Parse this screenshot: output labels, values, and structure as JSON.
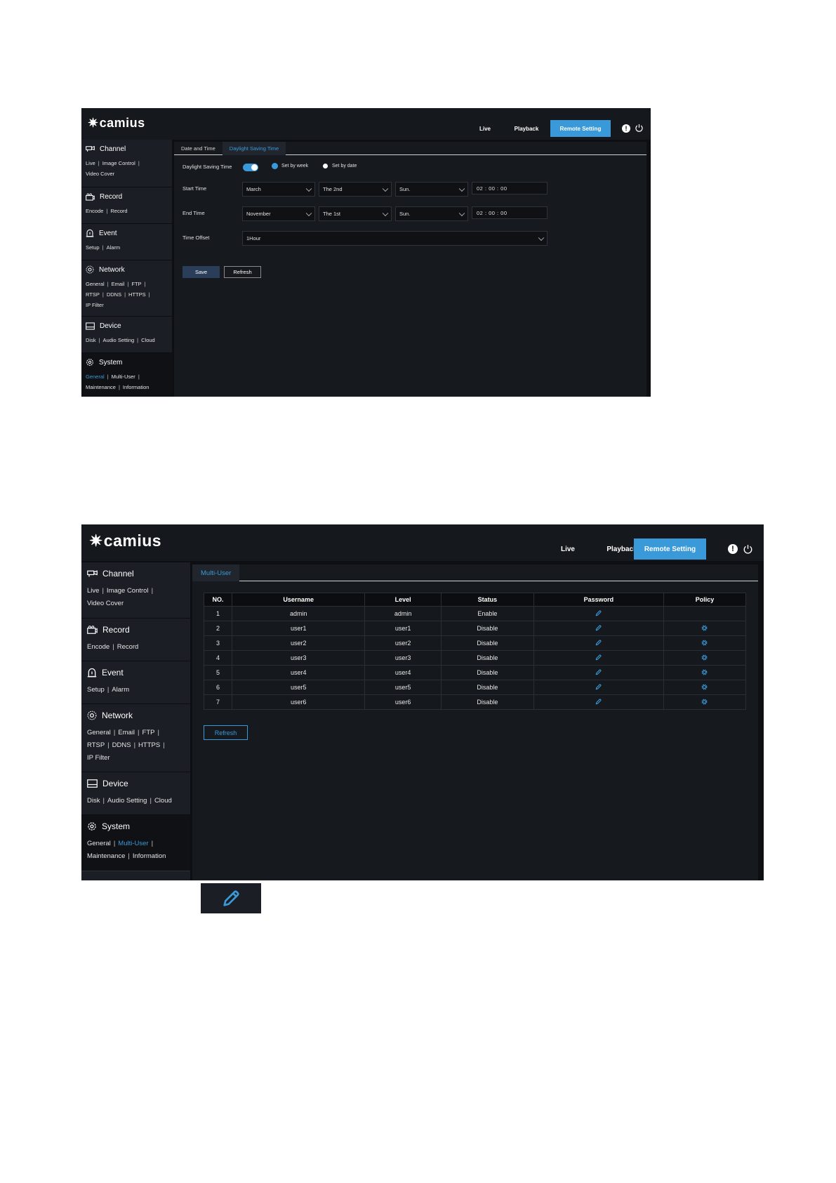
{
  "screen1": {
    "logo": "camius",
    "nav": {
      "live": "Live",
      "playback": "Playback",
      "remote": "Remote Setting"
    },
    "sidebar": [
      {
        "title": "Channel",
        "links": [
          "Live",
          "Image Control",
          "Video Cover"
        ]
      },
      {
        "title": "Record",
        "links": [
          "Encode",
          "Record"
        ]
      },
      {
        "title": "Event",
        "links": [
          "Setup",
          "Alarm"
        ]
      },
      {
        "title": "Network",
        "links": [
          "General",
          "Email",
          "FTP",
          "RTSP",
          "DDNS",
          "HTTPS",
          "IP Filter"
        ]
      },
      {
        "title": "Device",
        "links": [
          "Disk",
          "Audio Setting",
          "Cloud"
        ]
      },
      {
        "title": "System",
        "links": [
          "General",
          "Multi-User",
          "Maintenance",
          "Information"
        ]
      }
    ],
    "tabs": [
      "Date and Time",
      "Daylight Saving Time"
    ],
    "form": {
      "dst_label": "Daylight Saving Time",
      "dst_enabled": true,
      "radio_week": "Set by week",
      "radio_date": "Set by date",
      "start_label": "Start Time",
      "start_month": "March",
      "start_week": "The 2nd",
      "start_day": "Sun.",
      "start_time": "02  :  00  :  00",
      "end_label": "End Time",
      "end_month": "November",
      "end_week": "The 1st",
      "end_day": "Sun.",
      "end_time": "02  :  00  :  00",
      "offset_label": "Time Offset",
      "offset_value": "1Hour",
      "save": "Save",
      "refresh": "Refresh"
    }
  },
  "screen2": {
    "logo": "camius",
    "nav": {
      "live": "Live",
      "playback": "Playback",
      "remote": "Remote Setting"
    },
    "tabs": [
      "Multi-User"
    ],
    "table": {
      "headers": [
        "NO.",
        "Username",
        "Level",
        "Status",
        "Password",
        "Policy"
      ],
      "rows": [
        {
          "no": "1",
          "username": "admin",
          "level": "admin",
          "status": "Enable",
          "policy": false
        },
        {
          "no": "2",
          "username": "user1",
          "level": "user1",
          "status": "Disable",
          "policy": true
        },
        {
          "no": "3",
          "username": "user2",
          "level": "user2",
          "status": "Disable",
          "policy": true
        },
        {
          "no": "4",
          "username": "user3",
          "level": "user3",
          "status": "Disable",
          "policy": true
        },
        {
          "no": "5",
          "username": "user4",
          "level": "user4",
          "status": "Disable",
          "policy": true
        },
        {
          "no": "6",
          "username": "user5",
          "level": "user5",
          "status": "Disable",
          "policy": true
        },
        {
          "no": "7",
          "username": "user6",
          "level": "user6",
          "status": "Disable",
          "policy": true
        }
      ]
    },
    "refresh": "Refresh"
  },
  "colors": {
    "accent": "#3a9ad9",
    "background": "#0d0f13",
    "sidebar": "#1b1e24"
  },
  "icons": [
    "camera-icon",
    "record-icon",
    "event-icon",
    "network-icon",
    "device-icon",
    "system-icon",
    "alert-icon",
    "power-icon",
    "pencil-icon",
    "gear-icon"
  ]
}
